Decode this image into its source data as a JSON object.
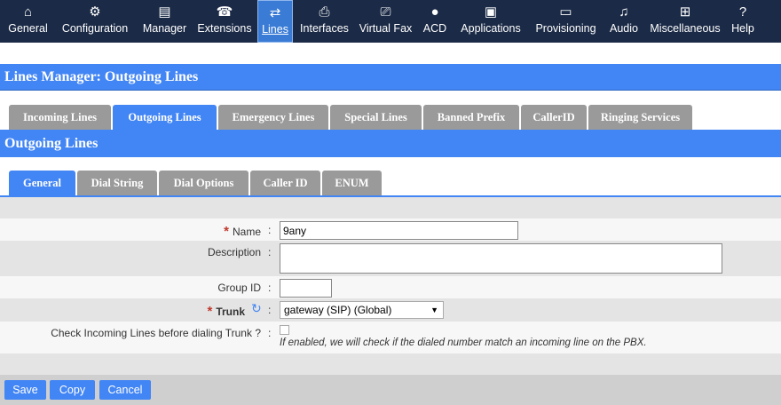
{
  "nav": [
    {
      "label": "General",
      "icon": "⌂"
    },
    {
      "label": "Configuration",
      "icon": "⚙"
    },
    {
      "label": "Manager",
      "icon": "▤"
    },
    {
      "label": "Extensions",
      "icon": "☎"
    },
    {
      "label": "Lines",
      "icon": "⇄"
    },
    {
      "label": "Interfaces",
      "icon": "⎙"
    },
    {
      "label": "Virtual Fax",
      "icon": "⎚"
    },
    {
      "label": "ACD",
      "icon": "●"
    },
    {
      "label": "Applications",
      "icon": "▣"
    },
    {
      "label": "Provisioning",
      "icon": "▭"
    },
    {
      "label": "Audio",
      "icon": "♫"
    },
    {
      "label": "Miscellaneous",
      "icon": "⊞"
    },
    {
      "label": "Help",
      "icon": "?"
    }
  ],
  "header": {
    "title": "Lines Manager:  Outgoing Lines"
  },
  "line_tabs": [
    "Incoming Lines",
    "Outgoing Lines",
    "Emergency Lines",
    "Special Lines",
    "Banned Prefix",
    "CallerID",
    "Ringing Services"
  ],
  "section": {
    "title": "Outgoing Lines"
  },
  "sub_tabs": [
    "General",
    "Dial String",
    "Dial Options",
    "Caller ID",
    "ENUM"
  ],
  "form": {
    "name_label": "Name",
    "name_value": "9any",
    "description_label": "Description",
    "description_value": "",
    "group_label": "Group ID",
    "group_value": "",
    "trunk_label": "Trunk",
    "trunk_value": "gateway (SIP) (Global)",
    "check_label": "Check Incoming Lines before dialing Trunk ?",
    "check_hint": "If enabled, we will check if the dialed number match an incoming line on the PBX."
  },
  "buttons": {
    "save": "Save",
    "copy": "Copy",
    "cancel": "Cancel"
  }
}
